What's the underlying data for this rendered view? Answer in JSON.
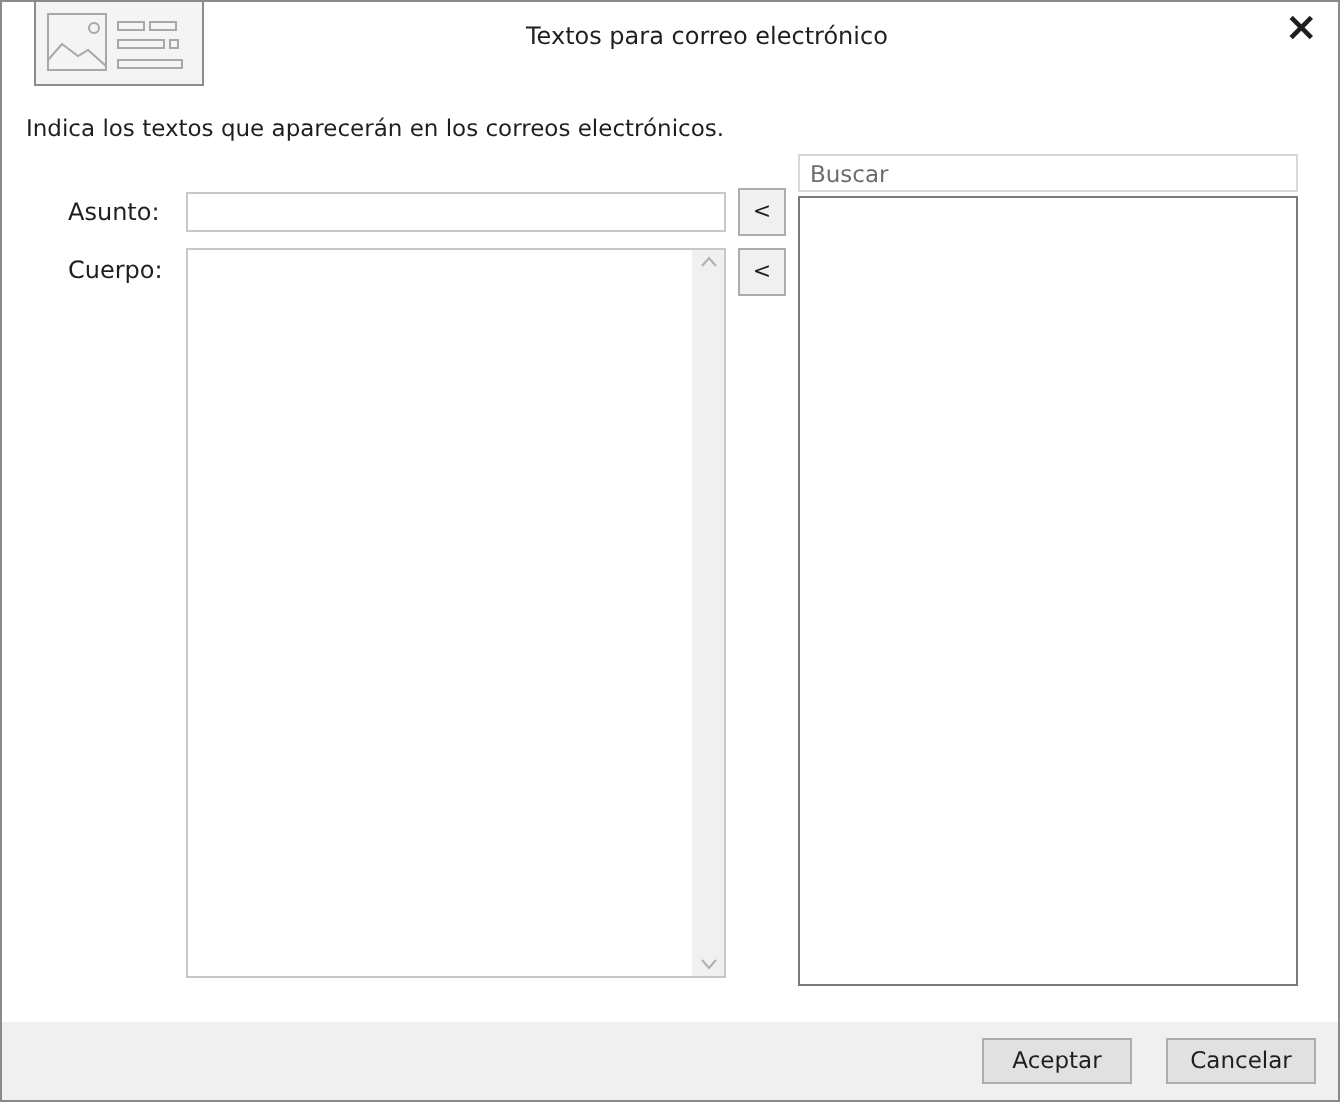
{
  "window": {
    "title": "Textos para correo electrónico",
    "close": "×"
  },
  "instruction": "Indica los textos que aparecerán en los correos electrónicos.",
  "subject": {
    "label": "Asunto:",
    "insert": "<"
  },
  "body": {
    "label": "Cuerpo:",
    "insert": "<"
  },
  "search": {
    "placeholder": "Buscar"
  },
  "buttons": [
    "Aceptar",
    "Cancelar"
  ]
}
